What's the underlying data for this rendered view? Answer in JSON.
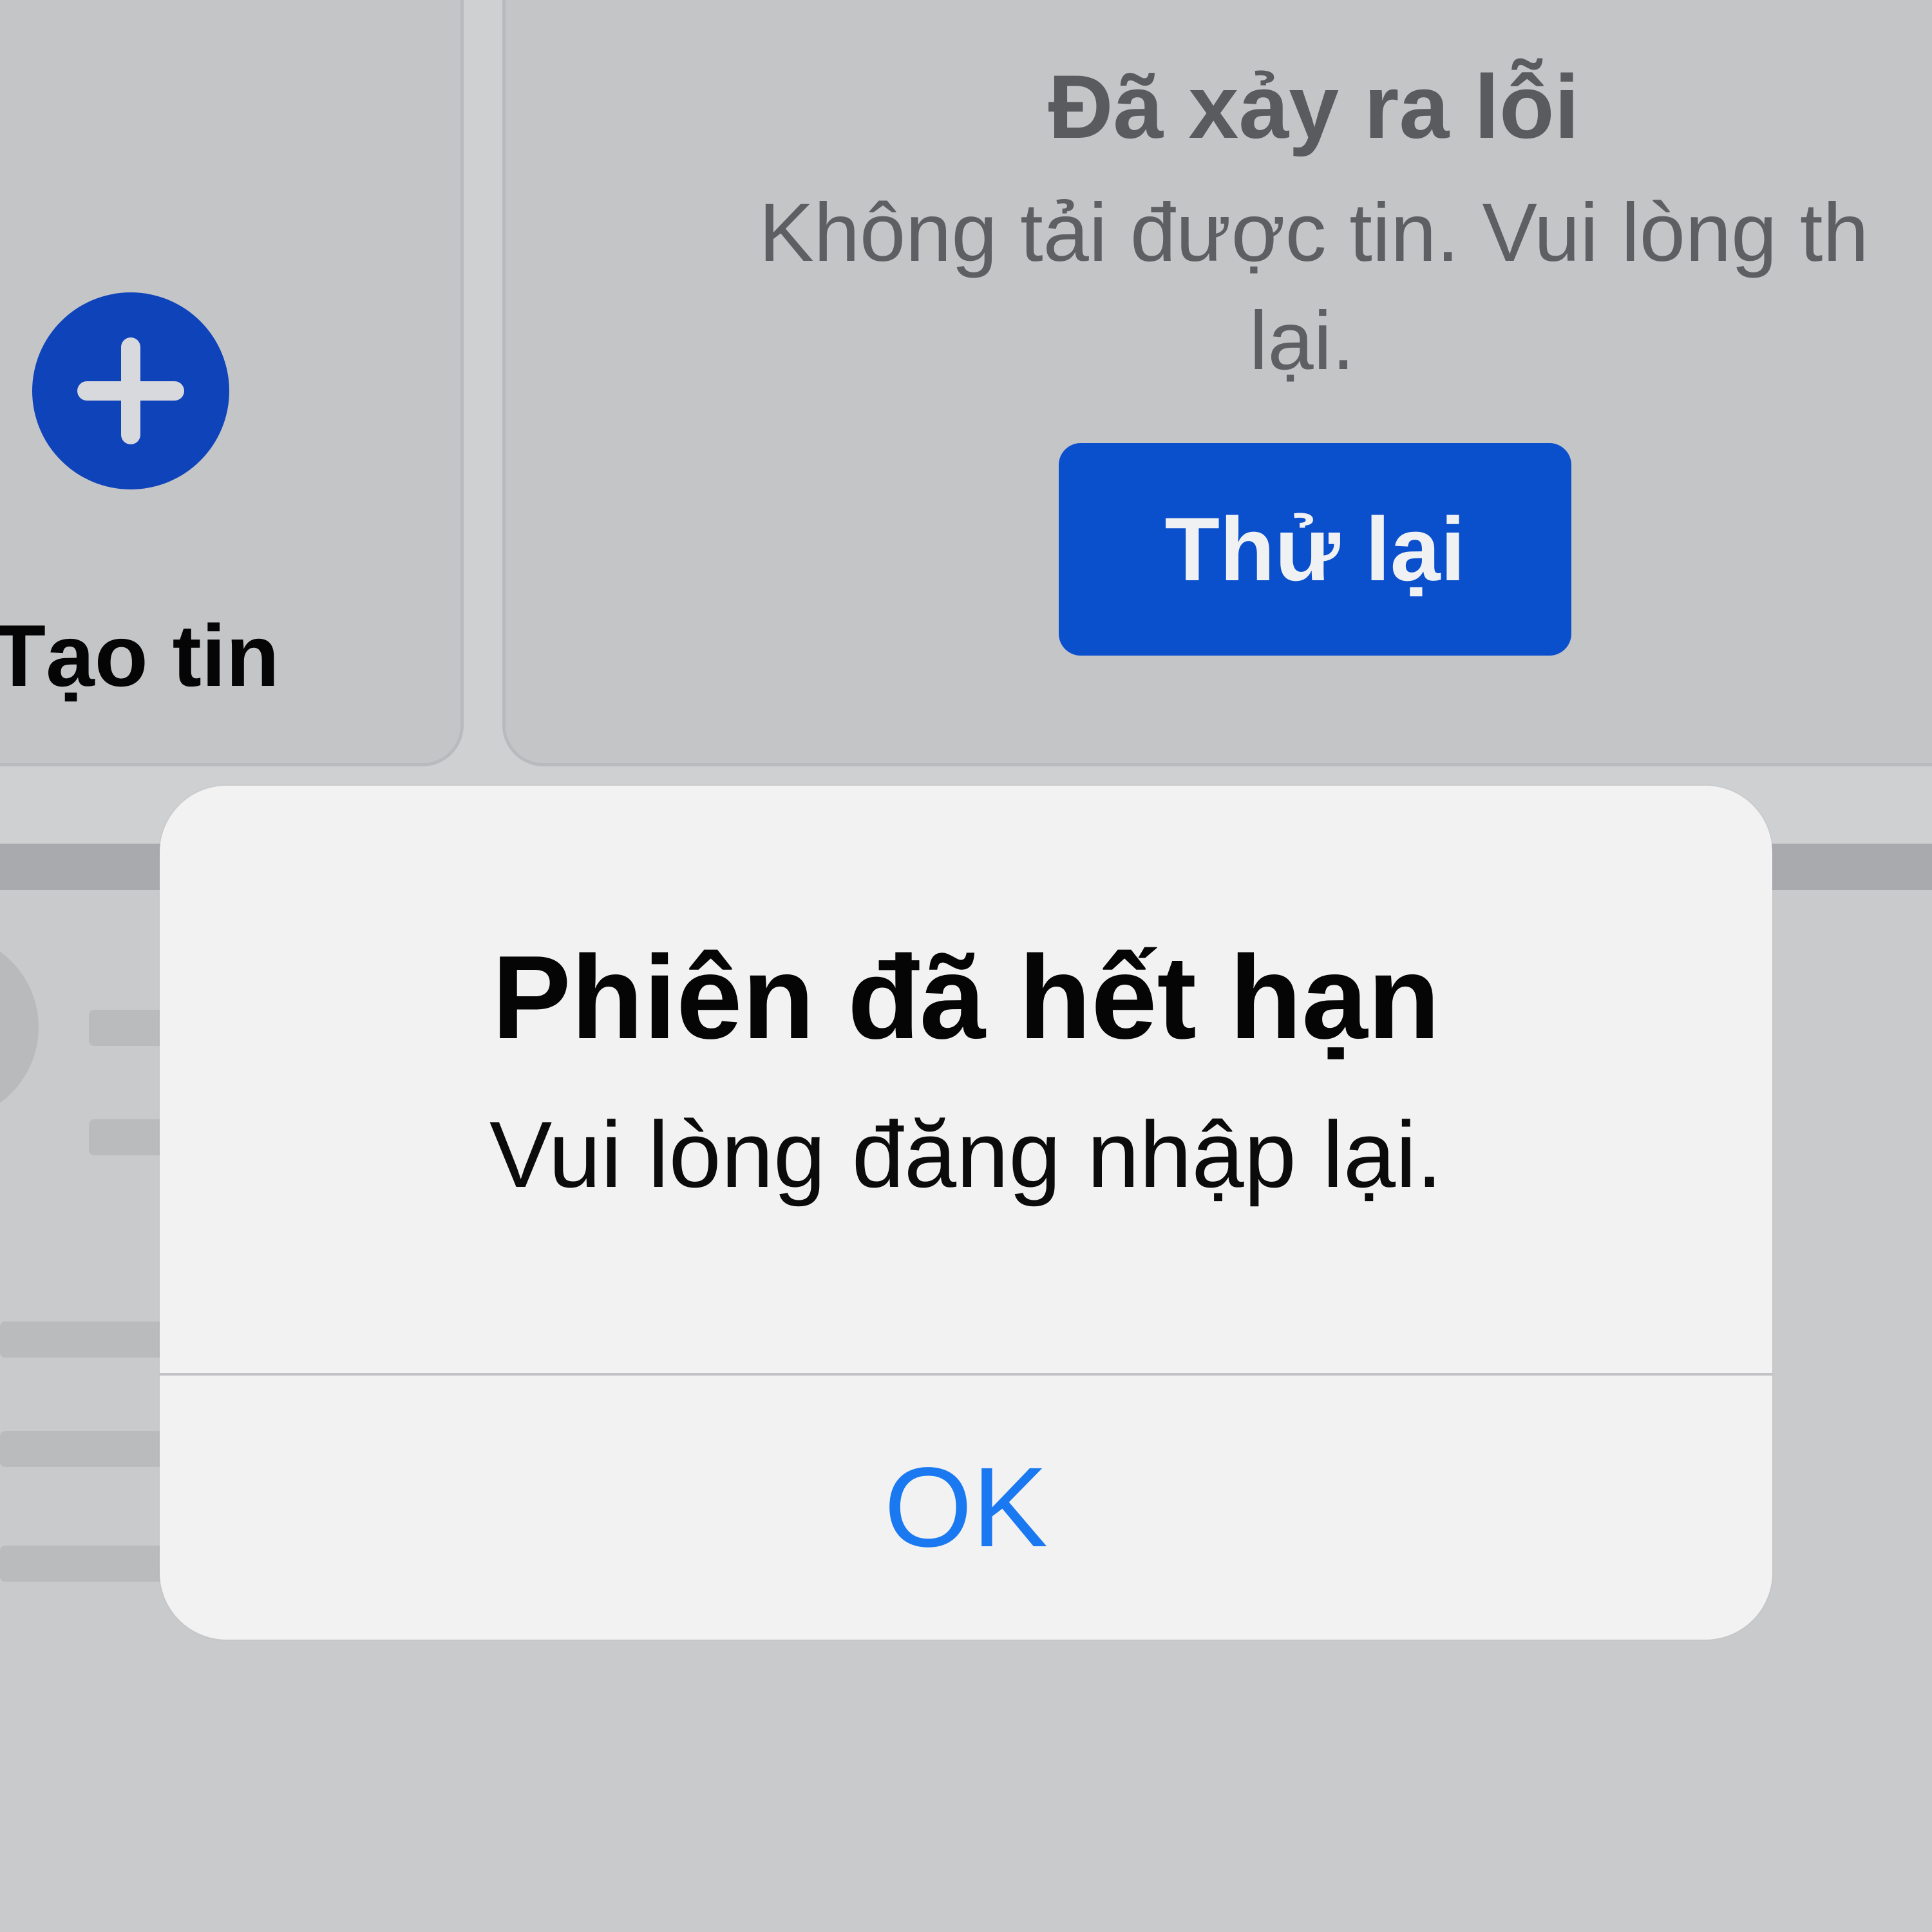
{
  "stories": {
    "create_story": {
      "label": "Tạo tin",
      "icon": "plus-icon"
    },
    "error_card": {
      "title": "Đã xảy ra lỗi",
      "message_line1": "Không tải được tin. Vui lòng th",
      "message_line2": "lại.",
      "retry_label": "Thử lại"
    }
  },
  "alert": {
    "title": "Phiên đã hết hạn",
    "message": "Vui lòng đăng nhập lại.",
    "ok_label": "OK"
  },
  "colors": {
    "brand_blue": "#0a4fcc",
    "ios_link_blue": "#1a79f0",
    "dialog_background": "#f2f2f3",
    "dimmed_background": "#cfd0d2"
  }
}
